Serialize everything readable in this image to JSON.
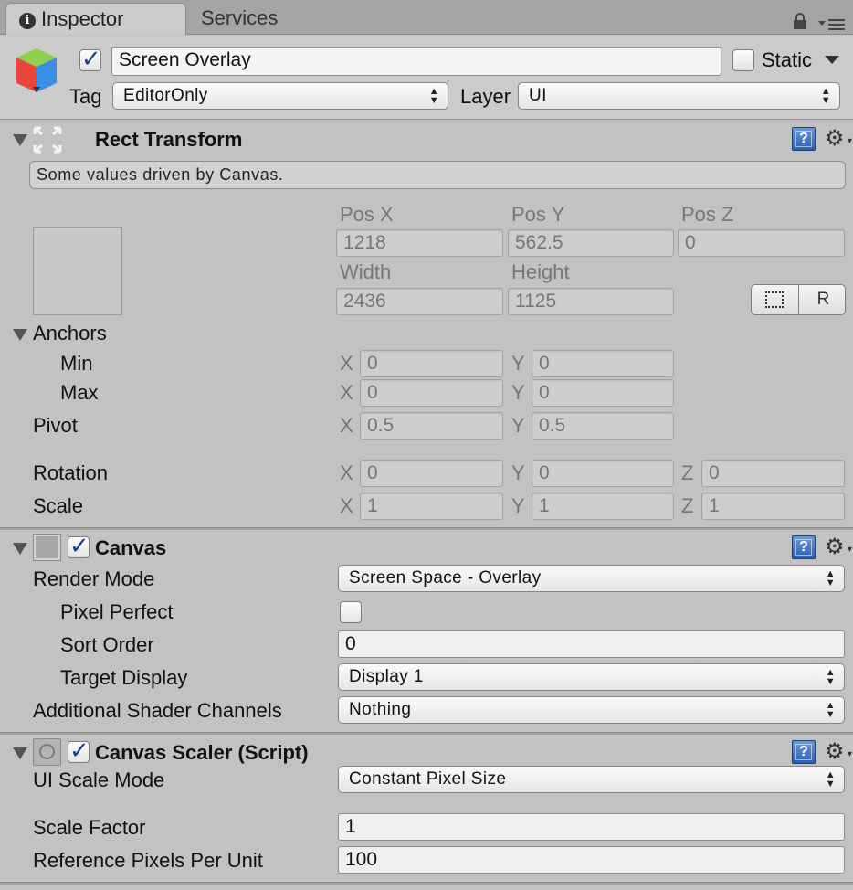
{
  "tabs": {
    "inspector_icon": "i",
    "inspector": "Inspector",
    "services": "Services"
  },
  "header": {
    "object_name": "Screen Overlay",
    "static_label": "Static",
    "tag_label": "Tag",
    "tag_value": "EditorOnly",
    "layer_label": "Layer",
    "layer_value": "UI"
  },
  "rect_transform": {
    "title": "Rect Transform",
    "info": "Some values driven by Canvas.",
    "pos_x_label": "Pos X",
    "pos_y_label": "Pos Y",
    "pos_z_label": "Pos Z",
    "pos_x": "1218",
    "pos_y": "562.5",
    "pos_z": "0",
    "width_label": "Width",
    "height_label": "Height",
    "width": "2436",
    "height": "1125",
    "raw_button": "R",
    "anchors_label": "Anchors",
    "min_label": "Min",
    "max_label": "Max",
    "min_x": "0",
    "min_y": "0",
    "max_x": "0",
    "max_y": "0",
    "pivot_label": "Pivot",
    "pivot_x": "0.5",
    "pivot_y": "0.5",
    "rotation_label": "Rotation",
    "rot_x": "0",
    "rot_y": "0",
    "rot_z": "0",
    "scale_label": "Scale",
    "scale_x": "1",
    "scale_y": "1",
    "scale_z": "1",
    "x": "X",
    "y": "Y",
    "z": "Z"
  },
  "canvas": {
    "title": "Canvas",
    "render_mode_label": "Render Mode",
    "render_mode": "Screen Space - Overlay",
    "pixel_perfect_label": "Pixel Perfect",
    "sort_order_label": "Sort Order",
    "sort_order": "0",
    "target_display_label": "Target Display",
    "target_display": "Display 1",
    "shader_channels_label": "Additional Shader Channels",
    "shader_channels": "Nothing"
  },
  "canvas_scaler": {
    "title": "Canvas Scaler (Script)",
    "ui_scale_mode_label": "UI Scale Mode",
    "ui_scale_mode": "Constant Pixel Size",
    "scale_factor_label": "Scale Factor",
    "scale_factor": "1",
    "ref_ppu_label": "Reference Pixels Per Unit",
    "ref_ppu": "100"
  },
  "help_glyph": "?"
}
